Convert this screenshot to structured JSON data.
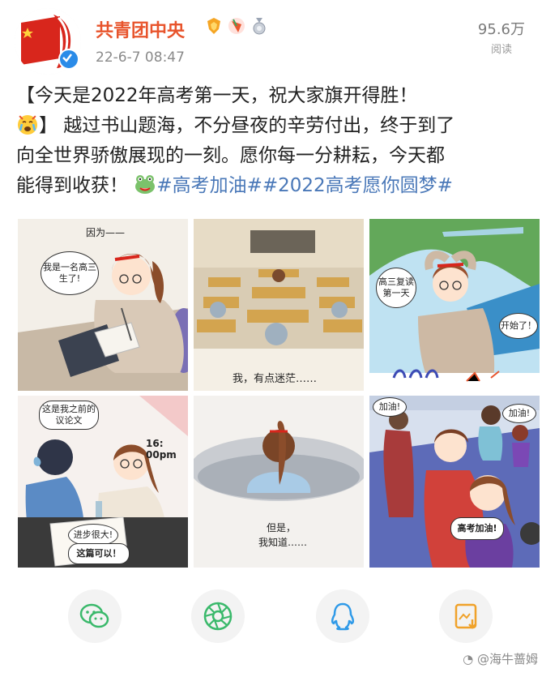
{
  "account": {
    "name": "共青团中央",
    "time": "22-6-7 08:47",
    "views_count": "95.6万",
    "views_label": "阅读"
  },
  "post": {
    "line1": "【今天是2022年高考第一天，祝大家旗开得胜！",
    "line2_text": "】 越过书山题海，不分昼夜的辛劳付出，终于到了",
    "line3": "向全世界骄傲展现的一刻。愿你每一分耕耘，今天都",
    "line4_text": "能得到收获！",
    "hashtag1": "#高考加油#",
    "hashtag2": "#2022高考愿你圆梦#"
  },
  "comic": {
    "p1_caption": "因为——",
    "p1_bubble": "我是一名高三生了!",
    "p2_caption": "我，有点迷茫……",
    "p3_bubble1": "高三复读第一天",
    "p3_bubble2": "开始了！",
    "p4_bubble1": "这是我之前的议论文",
    "p4_time": "16: 00pm",
    "p4_bubble2": "进步很大!",
    "p4_bubble3": "这篇可以！",
    "p5_caption_line1": "但是，",
    "p5_caption_line2": "我知道……",
    "p6_bubble1": "加油!",
    "p6_bubble2": "加油!",
    "p6_bubble3": "高考加油!"
  },
  "share": {
    "buttons": [
      "wechat-icon",
      "moments-icon",
      "qq-icon",
      "save-image-icon"
    ]
  },
  "watermark": "@海牛蔷姆",
  "colors": {
    "name": "#e8542c",
    "hashtag": "#4a78b8",
    "share_bg": "#f3f3f3"
  }
}
